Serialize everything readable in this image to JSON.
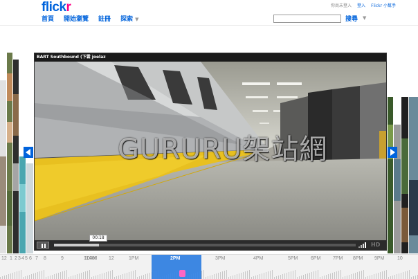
{
  "header": {
    "logo_part1": "flick",
    "logo_part2": "r",
    "nav": {
      "home": "首頁",
      "browse": "開始瀏覽",
      "signup": "註冊",
      "explore": "探索"
    },
    "toplinks": {
      "status": "你尚未登入",
      "login": "登入",
      "help": "Flickr 小幫手"
    },
    "search_button": "搜尋"
  },
  "video": {
    "title": "BART Southbound (下雲 joelaz",
    "watermark": "GURURU架站網",
    "current_time": "00:18",
    "progress": 0.15,
    "hd_label": "HD"
  },
  "timeline": {
    "labels": [
      "12",
      "1",
      "2",
      "3",
      "4",
      "5",
      "6",
      "7",
      "8",
      "9",
      "10AM",
      "11AM",
      "12",
      "1PM",
      "2PM",
      "3PM",
      "4PM",
      "5PM",
      "6PM",
      "7PM",
      "8PM",
      "9PM",
      "10"
    ],
    "selected_label": "2PM"
  },
  "colors": {
    "brand_blue": "#0063dc",
    "brand_pink": "#ff0084"
  },
  "icons": {
    "prev": "chevron-left-icon",
    "next": "chevron-right-icon",
    "pause": "pause-icon",
    "volume": "volume-icon"
  }
}
